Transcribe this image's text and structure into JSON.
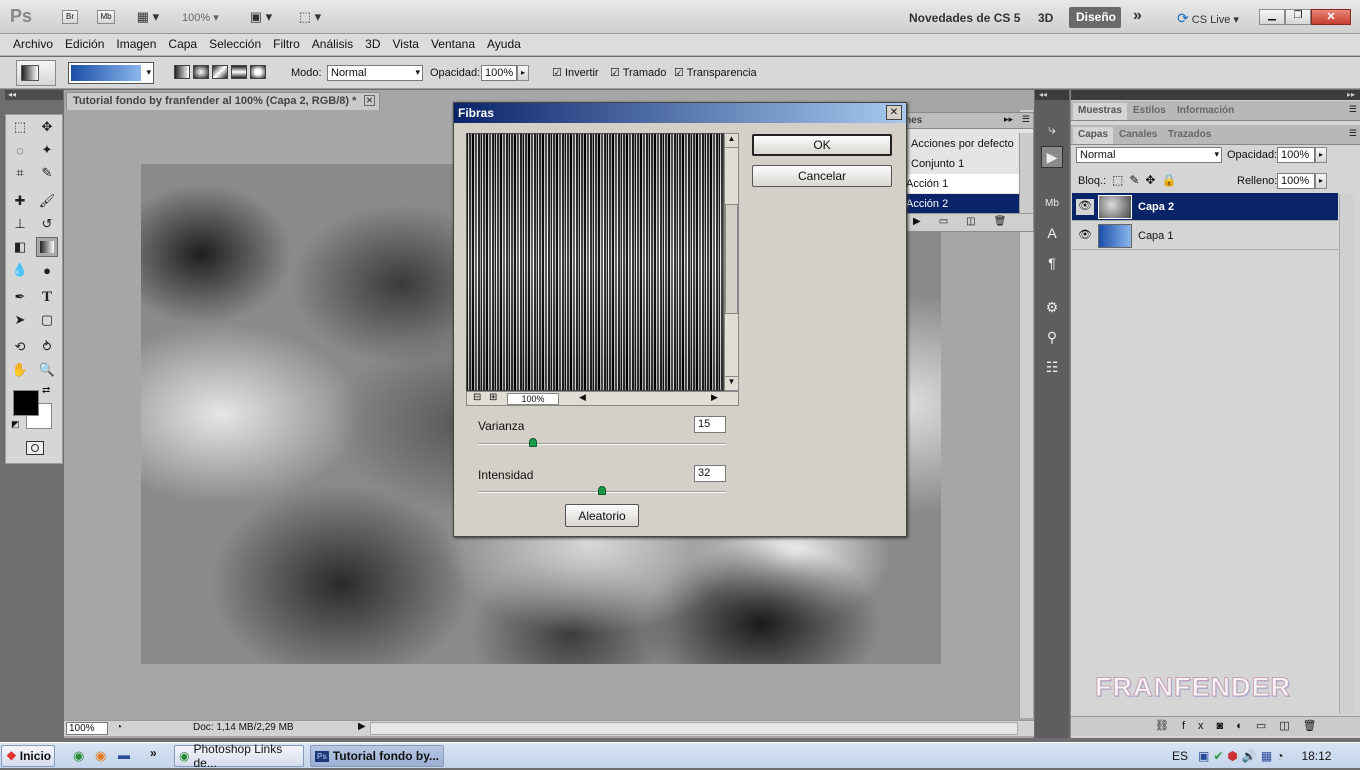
{
  "appbar": {
    "ps_logo": "Ps",
    "br": "Br",
    "mb": "Mb",
    "zoom": "100%",
    "novedades": "Novedades de CS 5",
    "three_d": "3D",
    "workspace": "Diseño",
    "cs_live": "CS Live"
  },
  "menu": [
    "Archivo",
    "Edición",
    "Imagen",
    "Capa",
    "Selección",
    "Filtro",
    "Análisis",
    "3D",
    "Vista",
    "Ventana",
    "Ayuda"
  ],
  "options": {
    "modo_label": "Modo:",
    "modo_value": "Normal",
    "opacidad_label": "Opacidad:",
    "opacidad_value": "100%",
    "invertir": "Invertir",
    "tramado": "Tramado",
    "transparencia": "Transparencia",
    "gradient_color_start": "#1c4fa8",
    "gradient_color_end": "#8ab6ec"
  },
  "document": {
    "tab_title": "Tutorial fondo by franfender al 100% (Capa 2, RGB/8) *",
    "zoom": "100%",
    "doc_info": "Doc: 1,14 MB/2,29 MB"
  },
  "actions_panel": {
    "tab": "nes",
    "items": [
      "Acciones por defecto",
      "Conjunto 1",
      "Acción 1",
      "Acción 2"
    ]
  },
  "dialog": {
    "title": "Fibras",
    "ok": "OK",
    "cancel": "Cancelar",
    "preview_zoom": "100%",
    "varianza_label": "Varianza",
    "varianza_value": "15",
    "varianza_level": 0.22,
    "intensidad_label": "Intensidad",
    "intensidad_value": "32",
    "intensidad_level": 0.5,
    "aleatorio": "Aleatorio"
  },
  "panels": {
    "top_tabs": [
      "Muestras",
      "Estilos",
      "Información"
    ],
    "layer_tabs": [
      "Capas",
      "Canales",
      "Trazados"
    ],
    "blend_mode": "Normal",
    "opacidad_label": "Opacidad:",
    "opacidad_value": "100%",
    "bloq_label": "Bloq.:",
    "relleno_label": "Relleno:",
    "relleno_value": "100%",
    "layers": [
      "Capa 2",
      "Capa 1"
    ],
    "watermark": "FRANFENDER"
  },
  "taskbar": {
    "start": "Inicio",
    "tasks": [
      "Photoshop Links de...",
      "Tutorial fondo by..."
    ],
    "lang": "ES",
    "clock": "18:12"
  }
}
